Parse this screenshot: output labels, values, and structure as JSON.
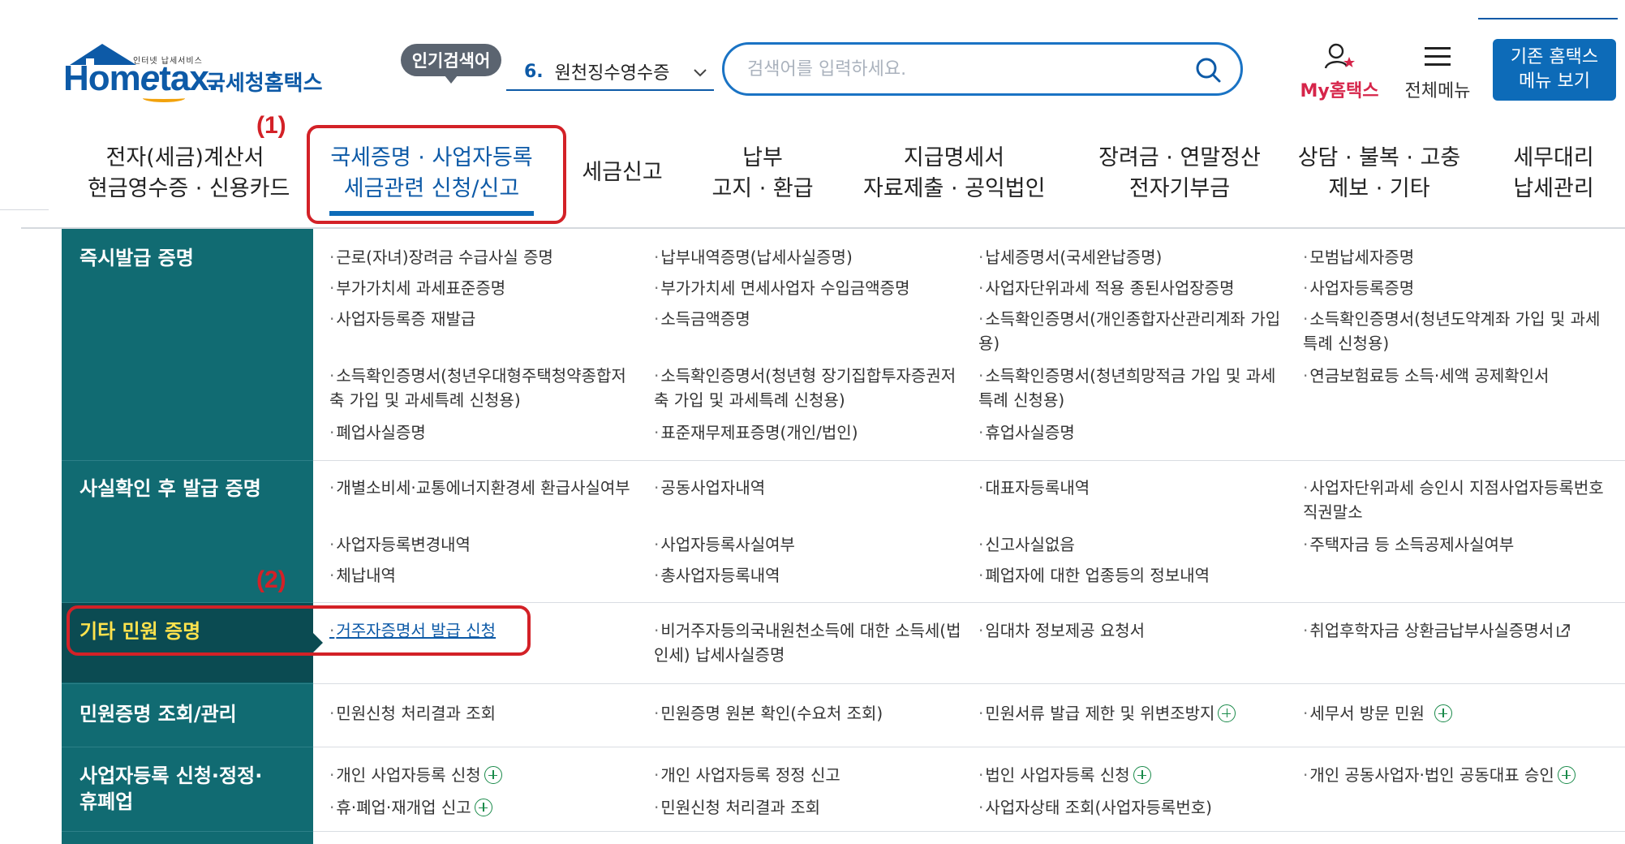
{
  "header": {
    "logo_small": "인터넷 납세서비스",
    "logo_main_a": "Hom",
    "logo_main_e": "e",
    "logo_main_b": "tax.",
    "logo_kor": "국세청홈택스",
    "popular_badge": "인기검색어",
    "popular_num": "6.",
    "popular_keyword": "원천징수영수증",
    "search_placeholder": "검색어를 입력하세요.",
    "my_hometax": "My홈택스",
    "all_menu": "전체메뉴",
    "legacy_btn_line1": "기존 홈택스",
    "legacy_btn_line2": "메뉴 보기"
  },
  "gnb": [
    {
      "line1": "전자(세금)계산서",
      "line2": "현금영수증 · 신용카드"
    },
    {
      "line1": "국세증명 · 사업자등록",
      "line2": "세금관련 신청/신고"
    },
    {
      "line1": "세금신고",
      "line2": ""
    },
    {
      "line1": "납부",
      "line2": "고지 · 환급"
    },
    {
      "line1": "지급명세서",
      "line2": "자료제출 · 공익법인"
    },
    {
      "line1": "장려금 · 연말정산",
      "line2": "전자기부금"
    },
    {
      "line1": "상담 · 불복 · 고충",
      "line2": "제보 · 기타"
    },
    {
      "line1": "세무대리",
      "line2": "납세관리"
    }
  ],
  "annotations": {
    "one": "(1)",
    "two": "(2)"
  },
  "menu": {
    "bullet": "·",
    "categories": [
      "즉시발급 증명",
      "사실확인 후 발급 증명",
      "기타 민원 증명",
      "민원증명 조회/관리",
      "사업자등록 신청·정정·",
      "휴폐업"
    ],
    "r1": [
      "근로(자녀)장려금 수급사실 증명",
      "납부내역증명(납세사실증명)",
      "납세증명서(국세완납증명)",
      "모범납세자증명",
      "부가가치세 과세표준증명",
      "부가가치세 면세사업자 수입금액증명",
      "사업자단위과세 적용 종된사업장증명",
      "사업자등록증명",
      "사업자등록증 재발급",
      "소득금액증명",
      "소득확인증명서(개인종합자산관리계좌 가입용)",
      "소득확인증명서(청년도약계좌 가입 및 과세특례 신청용)",
      "소득확인증명서(청년우대형주택청약종합저축 가입 및 과세특례 신청용)",
      "소득확인증명서(청년형 장기집합투자증권저축 가입 및 과세특례 신청용)",
      "소득확인증명서(청년희망적금 가입 및 과세특례 신청용)",
      "연금보험료등 소득·세액 공제확인서",
      "폐업사실증명",
      "표준재무제표증명(개인/법인)",
      "휴업사실증명"
    ],
    "r2": [
      "개별소비세·교통에너지환경세 환급사실여부",
      "공동사업자내역",
      "대표자등록내역",
      "사업자단위과세 승인시 지점사업자등록번호 직권말소",
      "사업자등록변경내역",
      "사업자등록사실여부",
      "신고사실없음",
      "주택자금 등 소득공제사실여부",
      "체납내역",
      "총사업자등록내역",
      "폐업자에 대한 업종등의 정보내역"
    ],
    "r3": [
      "거주자증명서 발급 신청",
      "비거주자등의국내원천소득에 대한 소득세(법인세) 납세사실증명",
      "임대차 정보제공 요청서",
      "취업후학자금 상환금납부사실증명서"
    ],
    "r4": [
      "민원신청 처리결과 조회",
      "민원증명 원본 확인(수요처 조회)",
      "민원서류 발급 제한 및 위변조방지",
      "세무서 방문 민원"
    ],
    "r5": [
      "개인 사업자등록 신청",
      "개인 사업자등록 정정 신고",
      "법인 사업자등록 신청",
      "개인 공동사업자·법인 공동대표 승인",
      "휴·폐업·재개업 신고",
      "민원신청 처리결과 조회",
      "사업자상태 조회(사업자등록번호)"
    ]
  },
  "colors": {
    "brand_blue": "#0d5aa7",
    "teal": "#116b72",
    "annotation_red": "#d32127",
    "active_yellow": "#ffe34d"
  }
}
